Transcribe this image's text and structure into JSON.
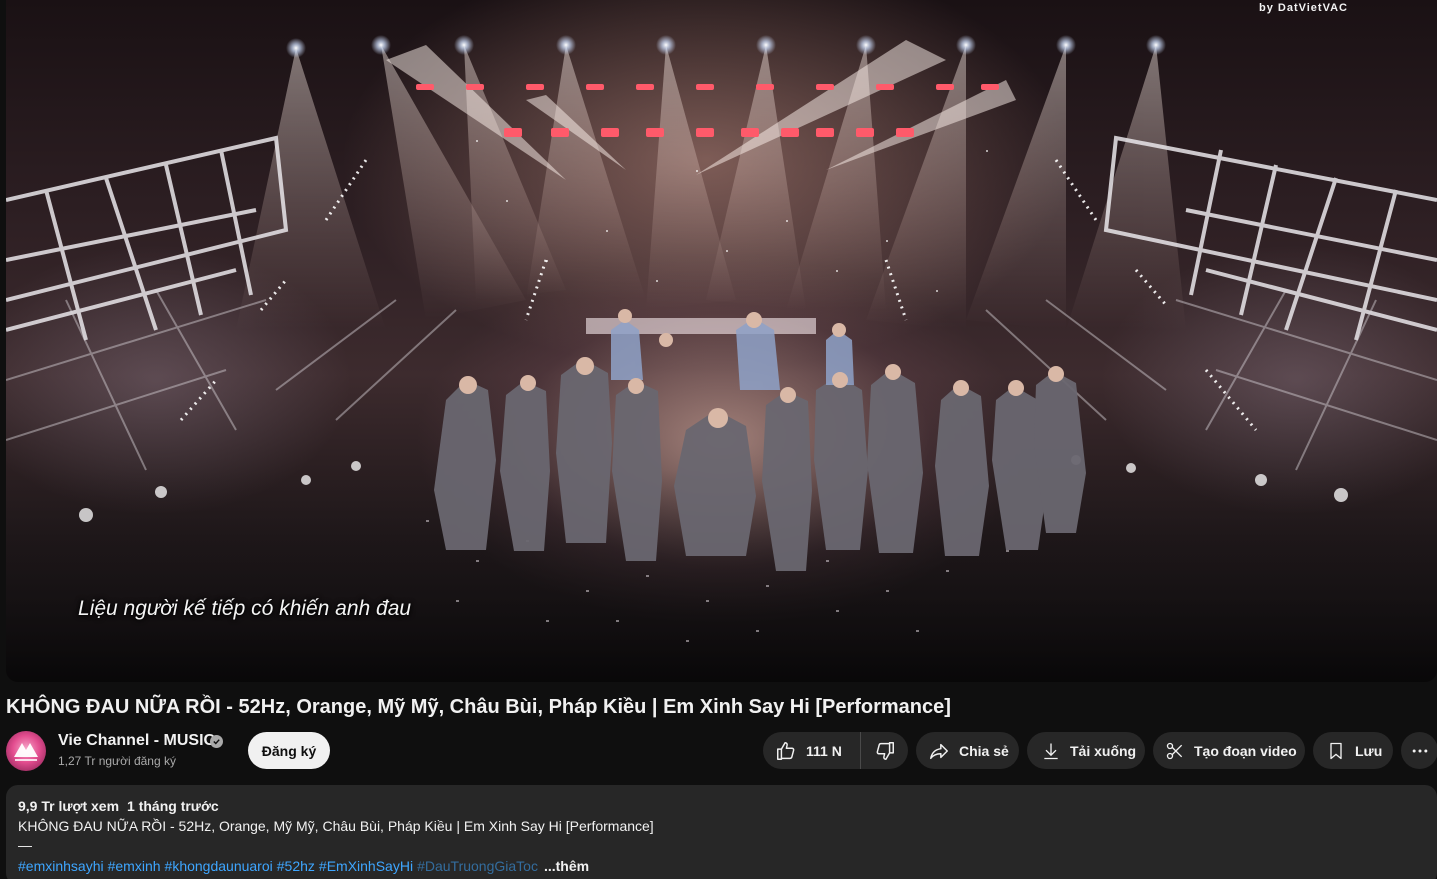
{
  "player": {
    "watermark": "by DatVietVAC",
    "subtitle": "Liệu người kế tiếp có khiến anh đau"
  },
  "video": {
    "title": "KHÔNG ĐAU NỮA RỒI - 52Hz, Orange, Mỹ Mỹ, Châu Bùi, Pháp Kiều | Em Xinh Say Hi [Performance]"
  },
  "channel": {
    "name": "Vie Channel - MUSIC",
    "subscribers": "1,27 Tr người đăng ký",
    "subscribe_label": "Đăng ký",
    "verified_icon": "verified-check-icon"
  },
  "actions": {
    "like_count": "111 N",
    "share_label": "Chia sẻ",
    "download_label": "Tải xuống",
    "clip_label": "Tạo đoạn video",
    "save_label": "Lưu"
  },
  "description": {
    "views": "9,9 Tr lượt xem",
    "age": "1 tháng trước",
    "first_line": "KHÔNG ĐAU NỮA RỒI - 52Hz, Orange, Mỹ Mỹ, Châu Bùi, Pháp Kiều | Em Xinh Say Hi [Performance]",
    "dash": "—",
    "hashtags": [
      "#emxinhsayhi",
      "#emxinh",
      "#khongdaunuaroi",
      "#52hz",
      "#EmXinhSayHi",
      "#DauTruongGiaToc"
    ],
    "more_label": "...thêm"
  },
  "colors": {
    "background": "#0f0f0f",
    "pill": "#272727",
    "link": "#3ea6ff",
    "subscribe_bg": "#f1f1f1"
  }
}
